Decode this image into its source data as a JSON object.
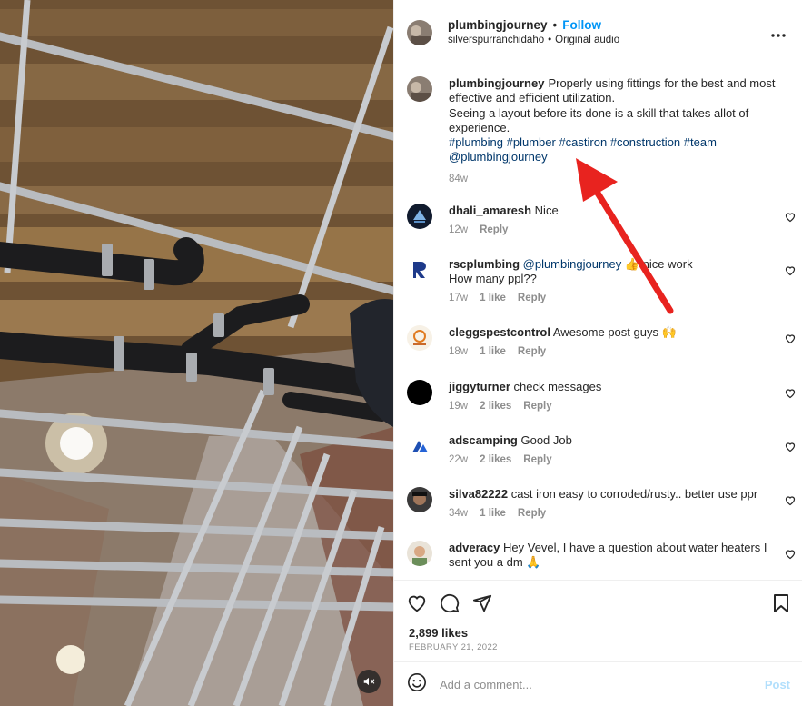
{
  "header": {
    "username": "plumbingjourney",
    "dot": "•",
    "follow_label": "Follow",
    "subtitle_user": "silverspurranchidaho",
    "subtitle_sep": "•",
    "subtitle_audio": "Original audio"
  },
  "caption": {
    "username": "plumbingjourney",
    "text_line1": "Properly using fittings for the best and most effective and efficient utilization.",
    "text_line2": "Seeing a layout before its done is a skill that takes allot of experience.",
    "hashtags": [
      "#plumbing",
      "#plumber",
      "#castiron",
      "#construction",
      "#team"
    ],
    "mention": "@plumbingjourney",
    "age": "84w"
  },
  "comments": [
    {
      "username": "dhali_amaresh",
      "text": "Nice",
      "age": "12w",
      "likes": "",
      "reply": "Reply"
    },
    {
      "username": "rscplumbing",
      "mention": "@plumbingjourney",
      "text": "👍 nice work\nHow many ppl??",
      "age": "17w",
      "likes": "1 like",
      "reply": "Reply"
    },
    {
      "username": "cleggspestcontrol",
      "text": "Awesome post guys 🙌",
      "age": "18w",
      "likes": "1 like",
      "reply": "Reply"
    },
    {
      "username": "jiggyturner",
      "text": "check messages",
      "age": "19w",
      "likes": "2 likes",
      "reply": "Reply"
    },
    {
      "username": "adscamping",
      "text": "Good Job",
      "age": "22w",
      "likes": "2 likes",
      "reply": "Reply"
    },
    {
      "username": "silva82222",
      "text": "cast iron easy to corroded/rusty.. better use ppr",
      "age": "34w",
      "likes": "1 like",
      "reply": "Reply"
    },
    {
      "username": "adveracy",
      "text": "Hey Vevel, I have a question about water heaters I sent you a dm 🙏",
      "age": "",
      "likes": "",
      "reply": ""
    }
  ],
  "footer": {
    "likes": "2,899 likes",
    "date": "FEBRUARY 21, 2022",
    "comment_placeholder": "Add a comment...",
    "post_label": "Post"
  },
  "icons": {
    "like": "heart-icon",
    "comment": "speech-bubble-icon",
    "share": "paper-plane-icon",
    "save": "bookmark-icon",
    "more": "ellipsis-icon",
    "emoji": "smiley-icon",
    "mute": "speaker-muted-icon"
  },
  "colors": {
    "follow": "#0095f6",
    "hashtag": "#00376b",
    "muted_text": "#8e8e8e",
    "post_disabled": "#b2dffc",
    "annotation_arrow": "#e8231f"
  }
}
